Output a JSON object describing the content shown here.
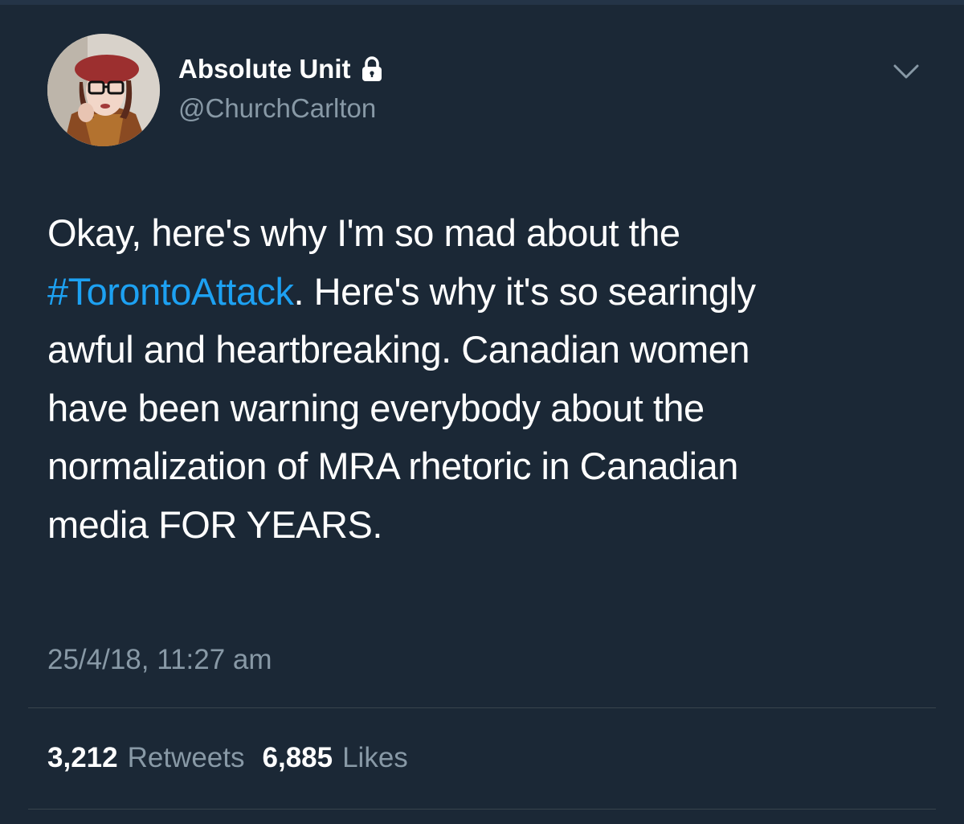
{
  "tweet": {
    "author": {
      "display_name": "Absolute Unit",
      "handle": "@ChurchCarlton",
      "avatar_icon": "profile-photo",
      "locked_icon": "lock-icon"
    },
    "text_lines": [
      [
        "Okay, here's why I'm so mad about the"
      ],
      [
        "#TorontoAttack",
        ". Here's why it's so searingly"
      ],
      [
        "awful and heartbreaking. Canadian women"
      ],
      [
        "have been warning everybody about the"
      ],
      [
        "normalization of MRA rhetoric in Canadian"
      ],
      [
        "media FOR YEARS."
      ]
    ],
    "hashtag": "#TorontoAttack",
    "timestamp": "25/4/18, 11:27 am",
    "stats": {
      "retweets_count": "3,212",
      "retweets_label": "Retweets",
      "likes_count": "6,885",
      "likes_label": "Likes"
    },
    "menu_icon": "chevron-down-icon"
  },
  "colors": {
    "background": "#1b2836",
    "text": "#ffffff",
    "muted": "#8899a6",
    "link": "#1da1f2",
    "divider": "#38444d"
  }
}
